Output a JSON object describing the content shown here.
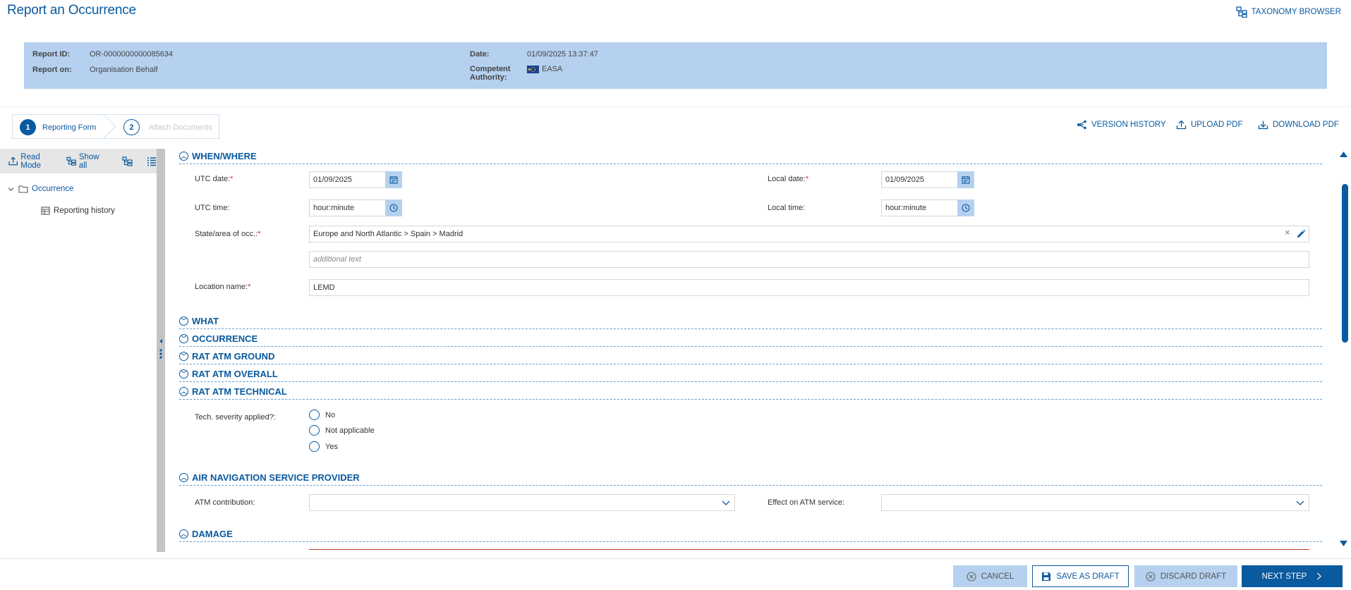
{
  "header": {
    "title": "Report an Occurrence",
    "taxonomy_label": "TAXONOMY BROWSER"
  },
  "info": {
    "report_id_label": "Report ID:",
    "report_id": "OR-0000000000085634",
    "report_on_label": "Report on:",
    "report_on": "Organisation Behalf",
    "date_label": "Date:",
    "date": "01/09/2025 13:37:47",
    "authority_label_1": "Competent",
    "authority_label_2": "Authority:",
    "authority": "EASA"
  },
  "stepper": {
    "step1_num": "1",
    "step1_label": "Reporting Form",
    "step2_num": "2",
    "step2_label": "Attach Documents"
  },
  "top_actions": {
    "version_history": "VERSION HISTORY",
    "upload_pdf": "UPLOAD PDF",
    "download_pdf": "DOWNLOAD PDF"
  },
  "sidebar": {
    "read_mode": "Read Mode",
    "show_all": "Show all",
    "tree_root": "Occurrence",
    "tree_child": "Reporting history"
  },
  "sections": {
    "when_where": "WHEN/WHERE",
    "what": "WHAT",
    "occurrence": "OCCURRENCE",
    "rat_ground": "RAT ATM GROUND",
    "rat_overall": "RAT ATM OVERALL",
    "rat_technical": "RAT ATM TECHNICAL",
    "ansp": "AIR NAVIGATION SERVICE PROVIDER",
    "damage": "DAMAGE"
  },
  "fields": {
    "utc_date_label": "UTC date:",
    "utc_date": "01/09/2025",
    "local_date_label": "Local date:",
    "local_date": "01/09/2025",
    "utc_time_label": "UTC time:",
    "utc_time": "hour:minute",
    "local_time_label": "Local time:",
    "local_time": "hour:minute",
    "state_label": "State/area of occ.:",
    "state_value": "Europe and North Atlantic > Spain > Madrid",
    "additional_placeholder": "additional text",
    "location_label": "Location name:",
    "location_value": "LEMD",
    "tech_severity_label": "Tech. severity applied?:",
    "radio_no": "No",
    "radio_na": "Not applicable",
    "radio_yes": "Yes",
    "atm_contribution_label": "ATM contribution:",
    "effect_atm_label": "Effect on ATM service:"
  },
  "bottom": {
    "cancel": "CANCEL",
    "save_draft": "SAVE AS DRAFT",
    "discard_draft": "DISCARD DRAFT",
    "next_step": "NEXT STEP"
  },
  "colors": {
    "brand": "#0a5aa0",
    "info_bg": "#b5d1ef",
    "next_bg": "#0a5aa0",
    "required": "#c0392b"
  }
}
